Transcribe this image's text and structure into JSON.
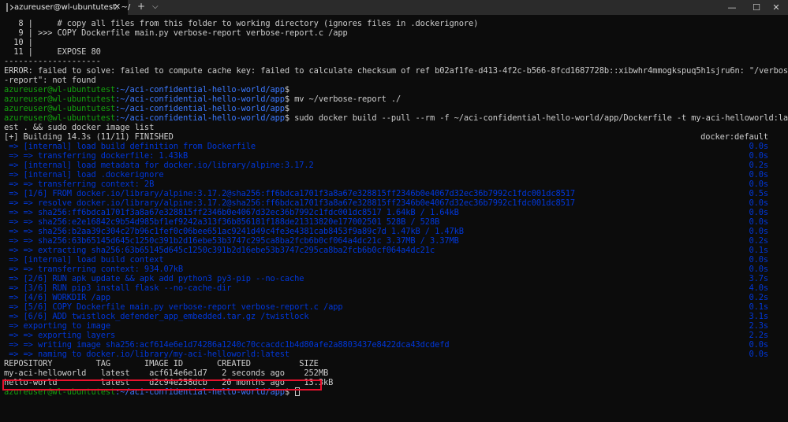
{
  "window": {
    "tab_title": "azureuser@wl-ubuntutest: ~/",
    "tab_close": "✕",
    "new_tab": "+",
    "dropdown": "⌵",
    "minimize": "—",
    "maximize": "☐",
    "close": "✕"
  },
  "colors": {
    "background": "#0c0c0c",
    "prompt_user": "#13a10e",
    "prompt_path": "#3b78ff",
    "build_step": "#0037da",
    "highlight": "#e8112d"
  },
  "terminal": {
    "context_lines": [
      "   8 |     # copy all files from this folder to working directory (ignores files in .dockerignore)",
      "   9 | >>> COPY Dockerfile main.py verbose-report verbose-report.c /app",
      "  10 |",
      "  11 |     EXPOSE 80",
      "--------------------",
      "ERROR: failed to solve: failed to compute cache key: failed to calculate checksum of ref b02af1fe-d413-4f2c-b566-8fcd1687728b::xibwhr4mmogkspuq5h1sjru6n: \"/verbose",
      "-report\": not found"
    ],
    "prompts": [
      {
        "user": "azureuser@wl-ubuntutest",
        "path": ":~/aci-confidential-hello-world/app",
        "cmd": "$"
      },
      {
        "user": "azureuser@wl-ubuntutest",
        "path": ":~/aci-confidential-hello-world/app",
        "cmd": "$ mv ~/verbose-report ./"
      },
      {
        "user": "azureuser@wl-ubuntutest",
        "path": ":~/aci-confidential-hello-world/app",
        "cmd": "$"
      },
      {
        "user": "azureuser@wl-ubuntutest",
        "path": ":~/aci-confidential-hello-world/app",
        "cmd": "$ sudo docker build --pull --rm -f ~/aci-confidential-hello-world/app/Dockerfile -t my-aci-helloworld:lat"
      }
    ],
    "wrap_line": "est . && sudo docker image list",
    "build_header": {
      "text": "[+] Building 14.3s (11/11) FINISHED",
      "time": "docker:default"
    },
    "build_steps": [
      {
        "text": " => [internal] load build definition from Dockerfile",
        "time": "0.0s"
      },
      {
        "text": " => => transferring dockerfile: 1.43kB",
        "time": "0.0s"
      },
      {
        "text": " => [internal] load metadata for docker.io/library/alpine:3.17.2",
        "time": "0.2s"
      },
      {
        "text": " => [internal] load .dockerignore",
        "time": "0.0s"
      },
      {
        "text": " => => transferring context: 2B",
        "time": "0.0s"
      },
      {
        "text": " => [1/6] FROM docker.io/library/alpine:3.17.2@sha256:ff6bdca1701f3a8a67e328815ff2346b0e4067d32ec36b7992c1fdc001dc8517",
        "time": "0.5s"
      },
      {
        "text": " => => resolve docker.io/library/alpine:3.17.2@sha256:ff6bdca1701f3a8a67e328815ff2346b0e4067d32ec36b7992c1fdc001dc8517",
        "time": "0.0s"
      },
      {
        "text": " => => sha256:ff6bdca1701f3a8a67e328815ff2346b0e4067d32ec36b7992c1fdc001dc8517 1.64kB / 1.64kB",
        "time": "0.0s"
      },
      {
        "text": " => => sha256:e2e16842c9b54d985bf1ef9242a313f36b856181f188de21313820e177002501 528B / 528B",
        "time": "0.0s"
      },
      {
        "text": " => => sha256:b2aa39c304c27b96c1fef0c06bee651ac9241d49c4fe3e4381cab8453f9a89c7d 1.47kB / 1.47kB",
        "time": "0.0s"
      },
      {
        "text": " => => sha256:63b65145d645c1250c391b2d16ebe53b3747c295ca8ba2fcb6b0cf064a4dc21c 3.37MB / 3.37MB",
        "time": "0.2s"
      },
      {
        "text": " => => extracting sha256:63b65145d645c1250c391b2d16ebe53b3747c295ca8ba2fcb6b0cf064a4dc21c",
        "time": "0.1s"
      },
      {
        "text": " => [internal] load build context",
        "time": "0.0s"
      },
      {
        "text": " => => transferring context: 934.07kB",
        "time": "0.0s"
      },
      {
        "text": " => [2/6] RUN apk update && apk add python3 py3-pip --no-cache",
        "time": "3.7s"
      },
      {
        "text": " => [3/6] RUN pip3 install flask --no-cache-dir",
        "time": "4.0s"
      },
      {
        "text": " => [4/6] WORKDIR /app",
        "time": "0.2s"
      },
      {
        "text": " => [5/6] COPY Dockerfile main.py verbose-report verbose-report.c /app",
        "time": "0.1s"
      },
      {
        "text": " => [6/6] ADD twistlock_defender_app_embedded.tar.gz /twistlock",
        "time": "3.1s"
      },
      {
        "text": " => exporting to image",
        "time": "2.3s"
      },
      {
        "text": " => => exporting layers",
        "time": "2.2s"
      },
      {
        "text": " => => writing image sha256:acf614e6e1d74286a1240c70ccacdc1b4d80afe2a8803437e8422dca43dcdefd",
        "time": "0.0s"
      },
      {
        "text": " => => naming to docker.io/library/my-aci-helloworld:latest",
        "time": "0.0s"
      }
    ],
    "image_table": {
      "header": "REPOSITORY         TAG       IMAGE ID       CREATED          SIZE",
      "rows": [
        "my-aci-helloworld   latest    acf614e6e1d7   2 seconds ago    252MB",
        "hello-world         latest    d2c94e258dcb   20 months ago    13.3kB"
      ]
    },
    "final_prompt": {
      "user": "azureuser@wl-ubuntutest",
      "path": ":~/aci-confidential-hello-world/app",
      "cmd": "$ "
    }
  }
}
